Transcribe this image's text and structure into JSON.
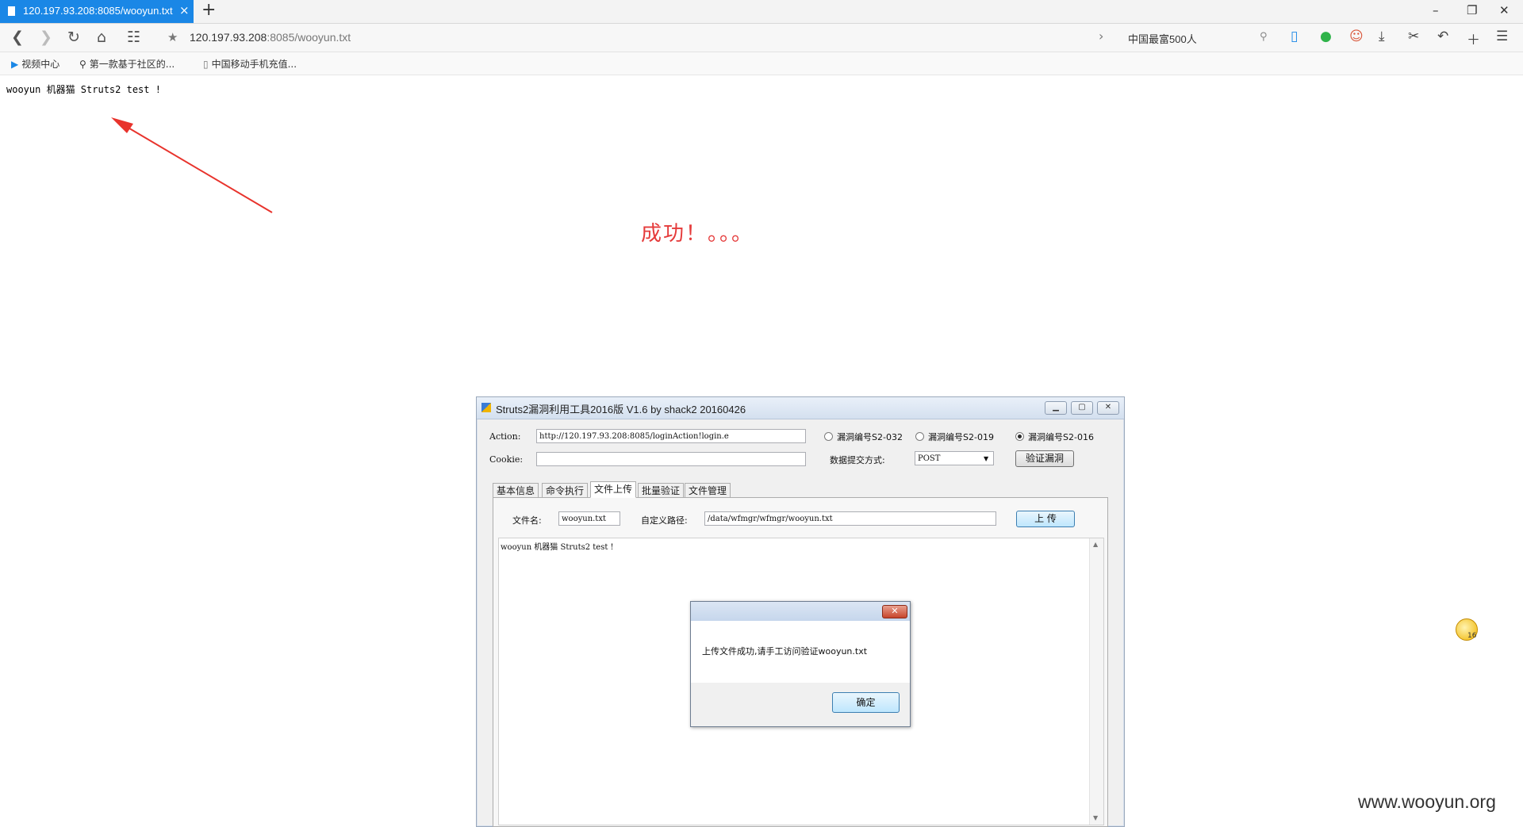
{
  "browser": {
    "tab_title": "120.197.93.208:8085/wooyun.txt",
    "tab_close": "×",
    "new_tab": "+",
    "window_controls": [
      "–",
      "❐",
      "✕"
    ],
    "url_host": "120.197.93.208",
    "url_rest": ":8085/wooyun.txt",
    "search_text": "中国最富500人",
    "bookmarks": [
      {
        "label": "视频中心",
        "icon": "video-icon"
      },
      {
        "label": "第一款基于社区的...",
        "icon": "search-icon"
      },
      {
        "label": "中国移动手机充值...",
        "icon": "page-icon"
      }
    ]
  },
  "page": {
    "text": "wooyun 机器猫 Struts2 test !",
    "success": "成功！。。。",
    "watermark": "www.wooyun.org",
    "notification_count": "16"
  },
  "tool": {
    "title": "Struts2漏洞利用工具2016版 V1.6 by shack2  20160426",
    "action_label": "Action:",
    "action_value": "http://120.197.93.208:8085/loginAction!login.e",
    "cookie_label": "Cookie:",
    "cookie_value": "",
    "radios": [
      {
        "label": "漏洞编号S2-032",
        "selected": false
      },
      {
        "label": "漏洞编号S2-019",
        "selected": false
      },
      {
        "label": "漏洞编号S2-016",
        "selected": true
      }
    ],
    "submit_label": "数据提交方式:",
    "submit_method": "POST",
    "verify_button": "验证漏洞",
    "tabs": [
      "基本信息",
      "命令执行",
      "文件上传",
      "批量验证",
      "文件管理"
    ],
    "active_tab": "文件上传",
    "filename_label": "文件名:",
    "filename_value": "wooyun.txt",
    "path_label": "自定义路径:",
    "path_value": "/data/wfmgr/wfmgr/wooyun.txt",
    "upload_button": "上 传",
    "content": "wooyun 机器猫 Struts2 test !"
  },
  "dialog": {
    "message": "上传文件成功,请手工访问验证wooyun.txt",
    "ok_button": "确定"
  },
  "colors": {
    "accent_tab": "#1a87e6",
    "success_red": "#e53b3b",
    "arrow_red": "#e8332c"
  }
}
